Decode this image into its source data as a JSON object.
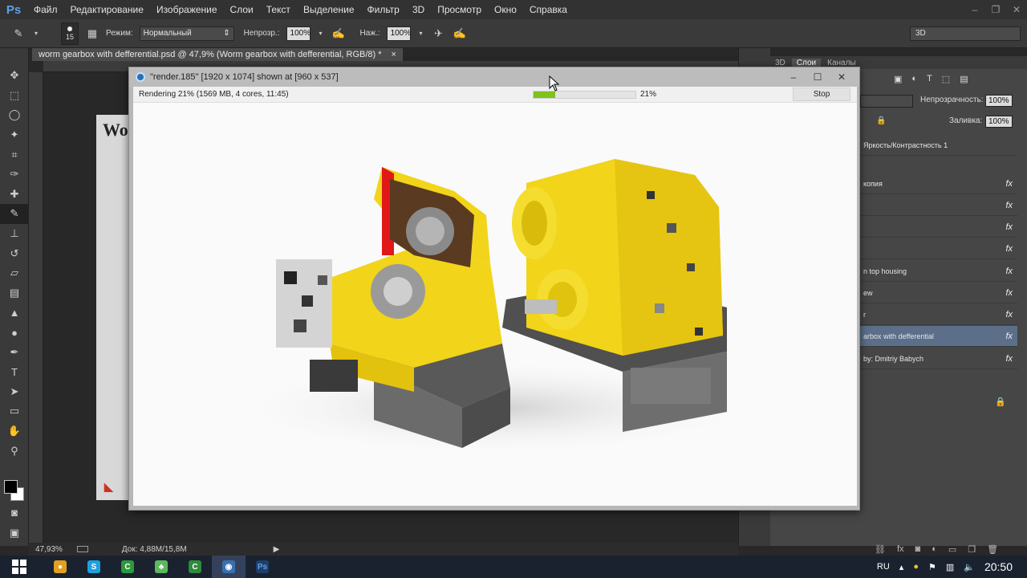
{
  "app": {
    "logo": "Ps"
  },
  "menu": [
    "Файл",
    "Редактирование",
    "Изображение",
    "Слои",
    "Текст",
    "Выделение",
    "Фильтр",
    "3D",
    "Просмотр",
    "Окно",
    "Справка"
  ],
  "options": {
    "brush_size": "15",
    "mode_label": "Режим:",
    "mode_value": "Нормальный",
    "opacity_label": "Непрозр.:",
    "opacity_value": "100%",
    "pressure_label": "Наж.:",
    "pressure_value": "100%",
    "workspace": "3D"
  },
  "document": {
    "tab_title": "worm gearbox with defferential.psd @ 47,9% (Worm gearbox with defferential, RGB/8) *",
    "tab_close": "×",
    "canvas_text": "Wo"
  },
  "status": {
    "zoom": "47,93%",
    "doc": "Док: 4,88M/15,8M"
  },
  "panels": {
    "tabs": [
      "3D",
      "Слои",
      "Каналы"
    ],
    "active_tab": "Слои",
    "opacity_label": "Непрозрачность:",
    "opacity_value": "100%",
    "fill_label": "Заливка:",
    "fill_value": "100%",
    "layers": [
      {
        "name": "Яркость/Контрастность 1",
        "fx": false,
        "selected": false
      },
      {
        "name": "копия",
        "fx": true,
        "selected": false
      },
      {
        "name": "",
        "fx": true,
        "selected": false
      },
      {
        "name": "",
        "fx": true,
        "selected": false
      },
      {
        "name": "",
        "fx": true,
        "selected": false
      },
      {
        "name": "n top housing",
        "fx": true,
        "selected": false
      },
      {
        "name": "ew",
        "fx": true,
        "selected": false
      },
      {
        "name": "r",
        "fx": true,
        "selected": false
      },
      {
        "name": "arbox with defferential",
        "fx": true,
        "selected": true
      },
      {
        "name": "by: Dmitriy Babych",
        "fx": true,
        "selected": false
      }
    ]
  },
  "render_window": {
    "title": "\"render.185\" [1920 x 1074] shown at [960 x 537]",
    "status_text": "Rendering 21% (1569 MB, 4 cores, 11:45)",
    "progress": 0.21,
    "progress_label": "21%",
    "stop_label": "Stop"
  },
  "taskbar": {
    "apps": [
      {
        "icon": "chrome-icon",
        "color": "#e0a020",
        "glyph": "●"
      },
      {
        "icon": "skype-icon",
        "color": "#1ea0e0",
        "glyph": "S"
      },
      {
        "icon": "camtasia-icon",
        "color": "#2c9a3c",
        "glyph": "C"
      },
      {
        "icon": "clover-icon",
        "color": "#5cb85c",
        "glyph": "♣"
      },
      {
        "icon": "camtasia-recorder-icon",
        "color": "#2e8b3a",
        "glyph": "C"
      },
      {
        "icon": "vray-icon",
        "color": "#3a6fb0",
        "glyph": "◉"
      },
      {
        "icon": "photoshop-icon",
        "color": "#1f3f6a",
        "glyph": "Ps"
      }
    ],
    "lang": "RU",
    "time": "20:50"
  },
  "colors": {
    "accent": "#5fa0e6",
    "progress": "#7ec21a",
    "gear_yellow": "#f2d41a",
    "housing_red": "#e01818"
  }
}
